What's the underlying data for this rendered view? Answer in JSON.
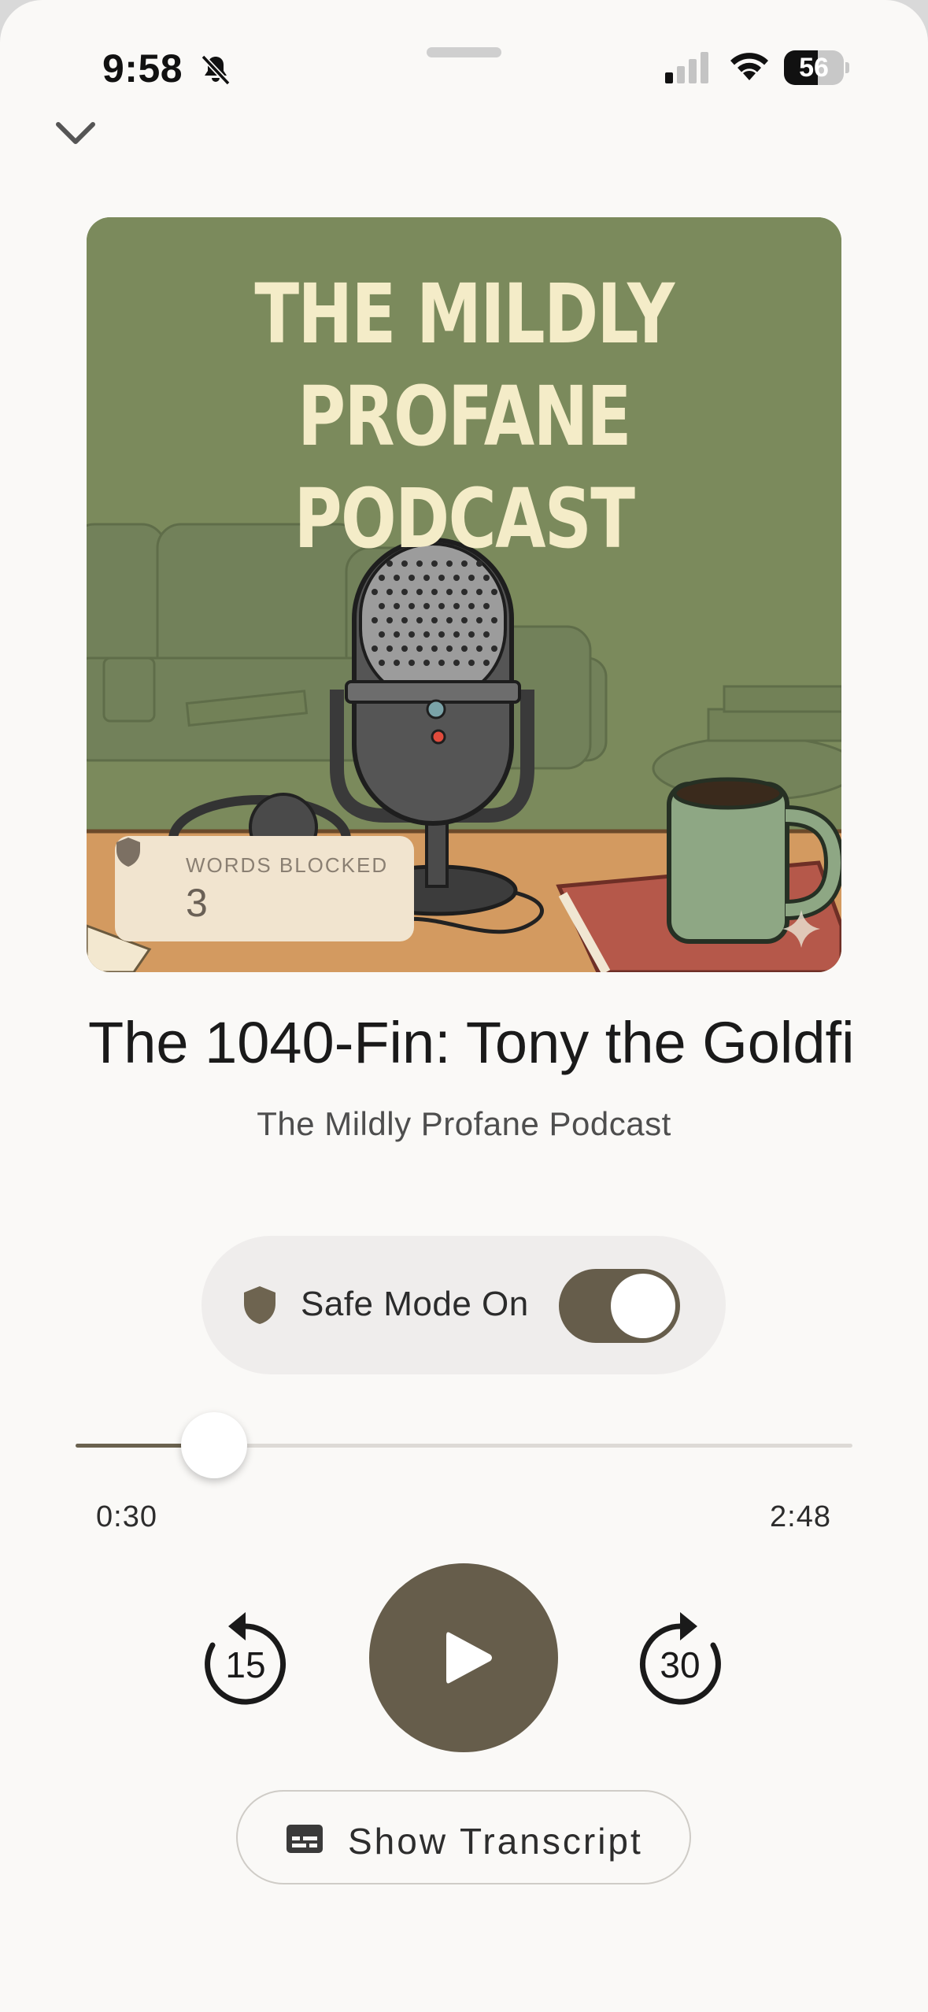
{
  "status_bar": {
    "time": "9:58",
    "battery": "56",
    "battery_level": 0.56,
    "icons": [
      "bell-slash-icon",
      "signal-icon",
      "wifi-icon",
      "battery-icon"
    ]
  },
  "header": {
    "collapse_icon": "chevron-down-icon"
  },
  "artwork": {
    "title_line1": "THE MILDLY",
    "title_line2": "PROFANE PODCAST",
    "words_blocked_label": "WORDS BLOCKED",
    "words_blocked_count": "3"
  },
  "episode": {
    "title": "The 1040-Fin: Tony the Goldfi",
    "show": "The Mildly Profane Podcast"
  },
  "safe_mode": {
    "label": "Safe Mode On",
    "enabled": true
  },
  "player": {
    "elapsed": "0:30",
    "total": "2:48",
    "progress": 0.1786,
    "skip_back": "15",
    "skip_forward": "30"
  },
  "transcript": {
    "label": "Show Transcript"
  },
  "colors": {
    "accent": "#665d4b",
    "background": "#faf9f7",
    "artwork_bg": "#7c8a5e"
  }
}
